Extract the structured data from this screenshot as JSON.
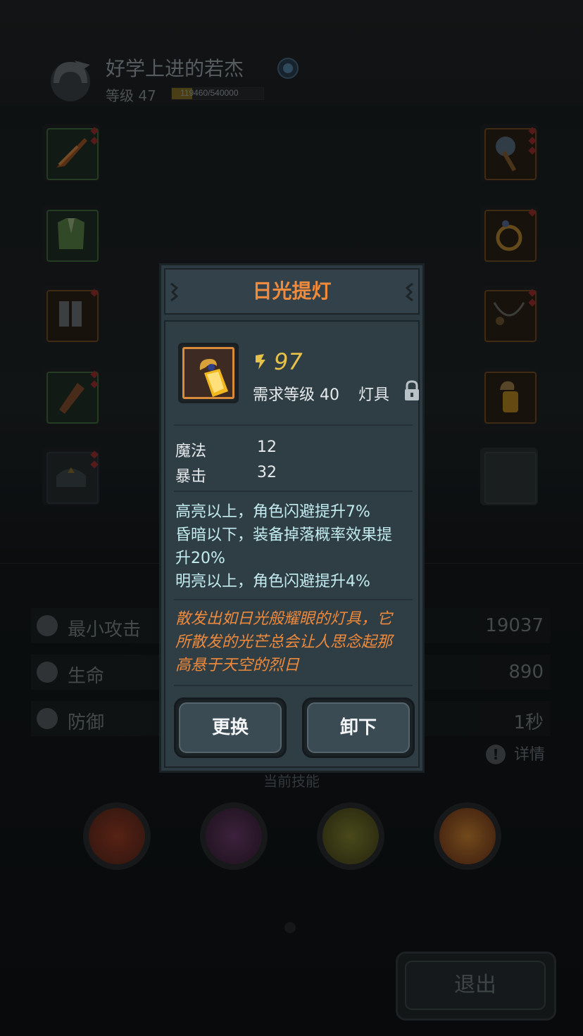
{
  "player": {
    "name": "好学上进的若杰",
    "level_label": "等级 47",
    "xp_text": "119460/540000",
    "xp_fraction": 0.221
  },
  "stats": [
    {
      "label": "最小攻击",
      "value": "19037",
      "icon": "sword-icon"
    },
    {
      "label": "生命",
      "value": "890",
      "icon": "heart-icon"
    },
    {
      "label": "防御",
      "value": "1秒",
      "icon": "shield-icon"
    }
  ],
  "detail_label": "详情",
  "skills_title": "当前技能",
  "skills": [
    "crossed-axes-skill-icon",
    "purple-blade-skill-icon",
    "yellow-orb-skill-icon",
    "explosion-skill-icon"
  ],
  "exit_label": "退出",
  "equipment_slots": {
    "left": [
      "boomerang-icon",
      "armor-icon",
      "boots-icon",
      "bracer-icon",
      "helmet-icon"
    ],
    "right": [
      "axe-icon",
      "ring-icon",
      "necklace-icon",
      "lantern-icon",
      "empty-slot"
    ]
  },
  "modal": {
    "title": "日光提灯",
    "power": "97",
    "requirement": "需求等级 40",
    "item_type": "灯具",
    "attributes": [
      {
        "name": "魔法",
        "value": "12"
      },
      {
        "name": "暴击",
        "value": "32"
      }
    ],
    "effects": [
      "高亮以上，角色闪避提升7%",
      "昏暗以下，装备掉落概率效果提",
      "升20%",
      "明亮以上，角色闪避提升4%"
    ],
    "description": [
      "散发出如日光般耀眼的灯具，它",
      "所散发的光芒总会让人思念起那",
      "高悬于天空的烈日"
    ],
    "buttons": {
      "replace": "更换",
      "unequip": "卸下"
    }
  },
  "colors": {
    "title_orange": "#f08a3c",
    "power_gold": "#e7c24a",
    "effect_cyan": "#c2ecef",
    "modal_bg": "#2f3d45"
  }
}
